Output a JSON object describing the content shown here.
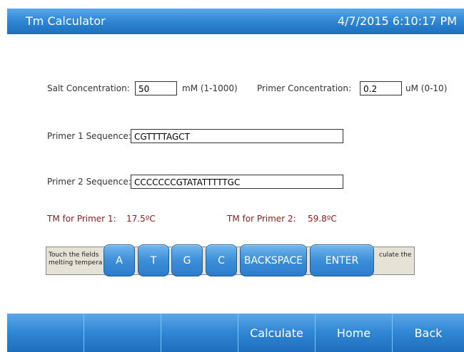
{
  "header": {
    "title": "Tm Calculator",
    "datetime": "4/7/2015 6:10:17 PM"
  },
  "form": {
    "salt_label": "Salt Concentration:",
    "salt_value": "50",
    "salt_unit": "mM (1-1000)",
    "primer_conc_label": "Primer  Concentration:",
    "primer_conc_value": "0.2",
    "primer_conc_unit": "uM (0-10)",
    "primer1_label": "Primer 1 Sequence:",
    "primer1_value": "CGTTTTAGCT",
    "primer2_label": "Primer 2 Sequence:",
    "primer2_value": "CCCCCCCGTATATTTTTGC"
  },
  "results": {
    "tm1_label": "TM for Primer 1:",
    "tm1_value": "17.5ºC",
    "tm2_label": "TM for Primer 2:",
    "tm2_value": "59.8ºC"
  },
  "help": {
    "left_line1": "Touch the fields",
    "left_line2": "melting tempera",
    "right_line1": "culate the"
  },
  "keypad": {
    "a": "A",
    "t": "T",
    "g": "G",
    "c": "C",
    "backspace": "BACKSPACE",
    "enter": "ENTER"
  },
  "nav": {
    "btn1": "",
    "btn2": "",
    "btn3": "",
    "calculate": "Calculate",
    "home": "Home",
    "back": "Back"
  },
  "colors": {
    "accent": "#2f86d3",
    "result_text": "#8b1a1a"
  }
}
